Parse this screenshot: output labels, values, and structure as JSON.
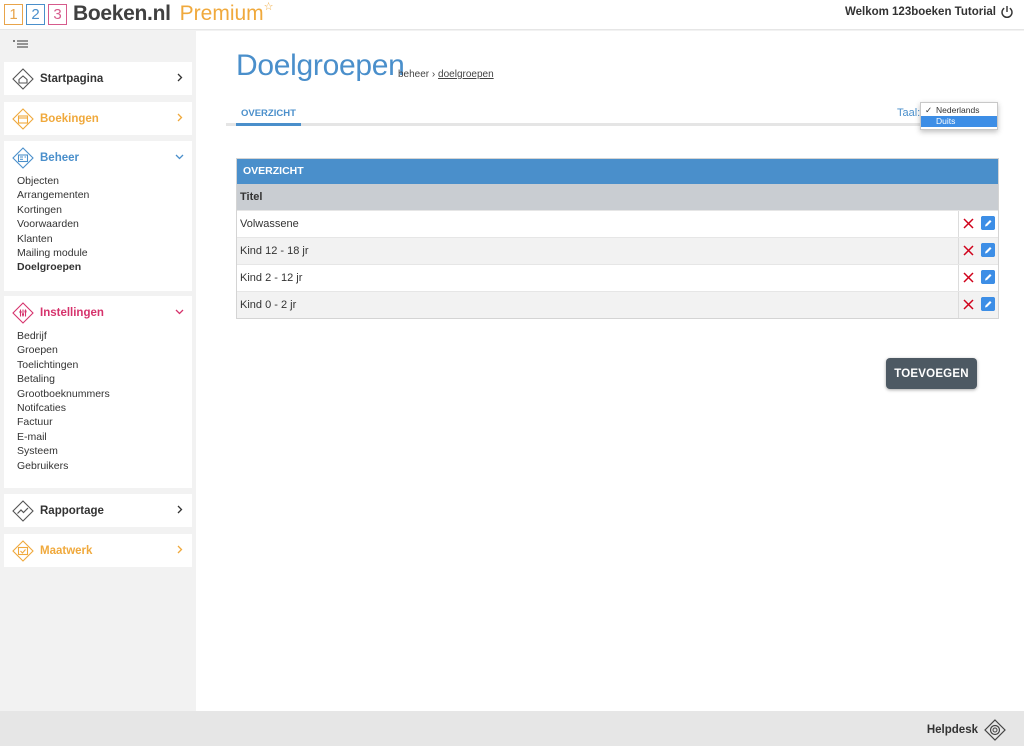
{
  "header": {
    "logo_digits": [
      "1",
      "2",
      "3"
    ],
    "logo_brand": "Boeken.nl",
    "logo_premium": "Premium",
    "logo_star": "☆",
    "welcome": "Welkom 123boeken Tutorial"
  },
  "sidebar": {
    "sections": [
      {
        "title": "Startpagina",
        "icon": "home-icon",
        "color": "#333333"
      },
      {
        "title": "Boekingen",
        "icon": "booking-icon",
        "color": "#f0a93c"
      },
      {
        "title": "Beheer",
        "icon": "manage-icon",
        "color": "#4a8fcb",
        "items": [
          "Objecten",
          "Arrangementen",
          "Kortingen",
          "Voorwaarden",
          "Klanten",
          "Mailing module",
          "Doelgroepen"
        ],
        "active": "Doelgroepen"
      },
      {
        "title": "Instellingen",
        "icon": "settings-icon",
        "color": "#d6336c",
        "items": [
          "Bedrijf",
          "Groepen",
          "Toelichtingen",
          "Betaling",
          "Grootboeknummers",
          "Notifcaties",
          "Factuur",
          "E-mail",
          "Systeem",
          "Gebruikers"
        ]
      },
      {
        "title": "Rapportage",
        "icon": "chart-icon",
        "color": "#333333"
      },
      {
        "title": "Maatwerk",
        "icon": "custom-icon",
        "color": "#f0a93c"
      }
    ]
  },
  "main": {
    "title": "Doelgroepen",
    "breadcrumb": {
      "first": "beheer",
      "separator": "›",
      "current": "doelgroepen"
    },
    "tab": "OVERZICHT",
    "language": {
      "label": "Taal:",
      "options": [
        "Nederlands",
        "Duits"
      ],
      "checked": "Nederlands",
      "highlighted": "Duits"
    },
    "panel": {
      "title": "OVERZICHT",
      "column": "Titel",
      "rows": [
        "Volwassene",
        "Kind 12 - 18 jr",
        "Kind 2 - 12 jr",
        "Kind 0 - 2 jr"
      ]
    },
    "add_button": "TOEVOEGEN"
  },
  "footer": {
    "helpdesk": "Helpdesk"
  },
  "colors": {
    "accent_blue": "#4a8fcb",
    "orange": "#f0a93c",
    "pink": "#d6336c",
    "delete_red": "#d0021b",
    "button_dark": "#4d5963"
  }
}
